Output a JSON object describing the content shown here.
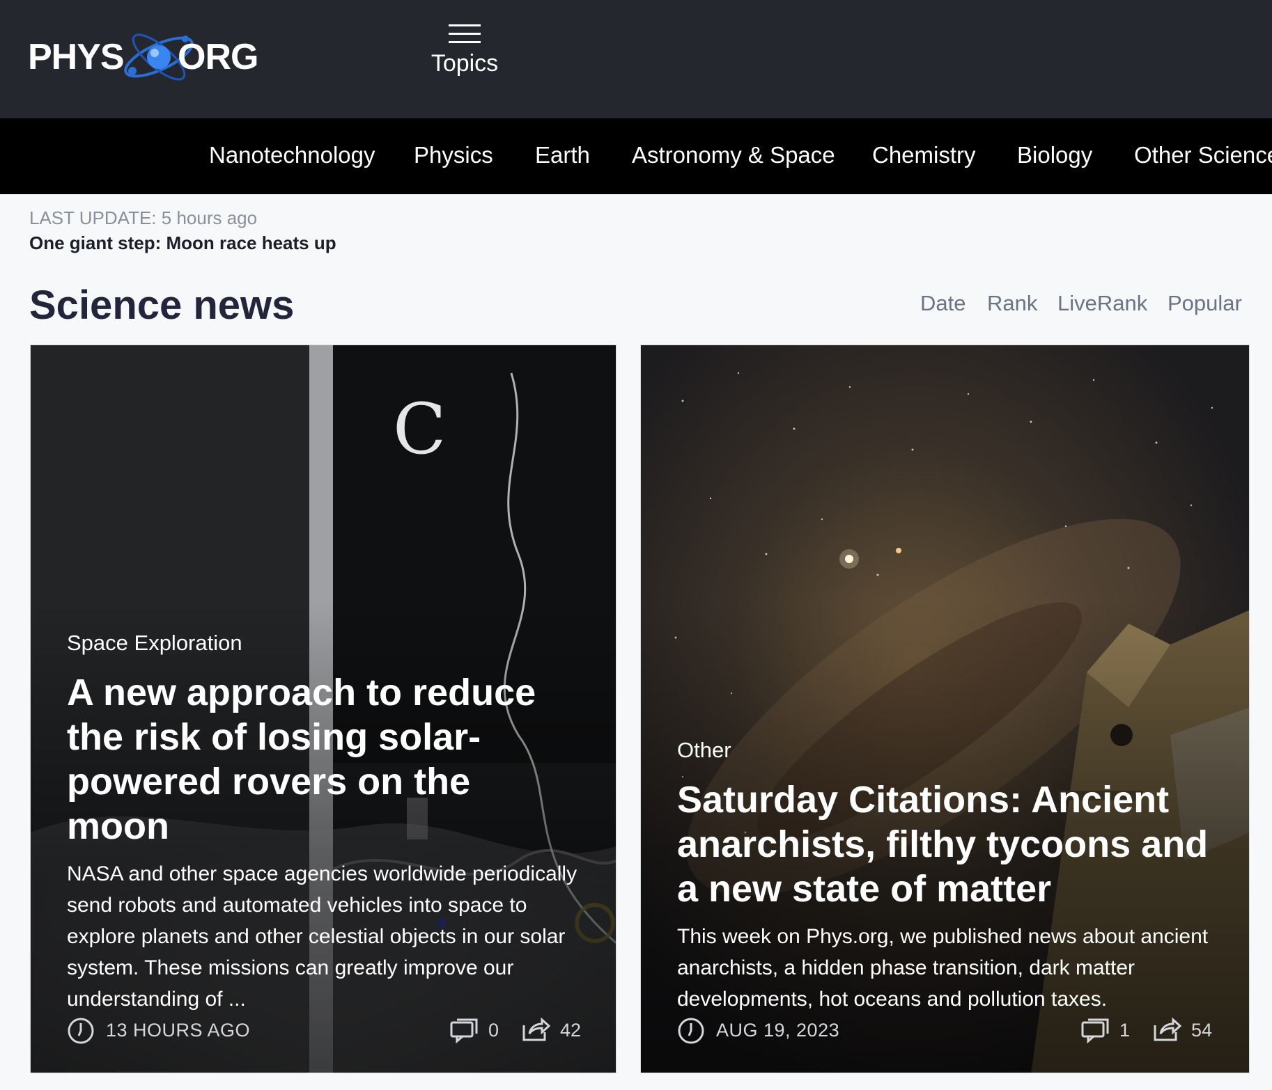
{
  "header": {
    "logo_left": "PHYS",
    "logo_right": "ORG",
    "topics_label": "Topics"
  },
  "nav": {
    "items": [
      "Nanotechnology",
      "Physics",
      "Earth",
      "Astronomy & Space",
      "Chemistry",
      "Biology",
      "Other Sciences"
    ]
  },
  "update": {
    "last_update": "LAST UPDATE: 5 hours ago",
    "headline": "One giant step: Moon race heats up"
  },
  "section": {
    "title": "Science news",
    "sort_tabs": [
      "Date",
      "Rank",
      "LiveRank",
      "Popular"
    ]
  },
  "articles": [
    {
      "category": "Space Exploration",
      "title": "A new approach to reduce the risk of losing solar-powered rovers on the moon",
      "summary": "NASA and other space agencies worldwide periodically send robots and automated vehicles into space to explore planets and other celestial objects in our solar system. These missions can greatly improve our understanding of ...",
      "time": "13 HOURS AGO",
      "comments": "0",
      "shares": "42"
    },
    {
      "category": "Other",
      "title": "Saturday Citations: Ancient anarchists, filthy tycoons and a new state of matter",
      "summary": "This week on Phys.org, we published news about ancient anarchists, a hidden phase transition, dark matter developments, hot oceans and pollution taxes.",
      "time": "AUG 19, 2023",
      "comments": "1",
      "shares": "54"
    }
  ],
  "icons": {
    "logo": "atom-logo-icon",
    "menu": "hamburger-menu-icon",
    "clock": "clock-icon",
    "comment": "comment-icon",
    "share": "share-icon"
  },
  "colors": {
    "header_bg": "#25272f",
    "nav_bg": "#000000",
    "page_bg": "#f7f8fa",
    "logo_accent": "#2b6fd6"
  }
}
